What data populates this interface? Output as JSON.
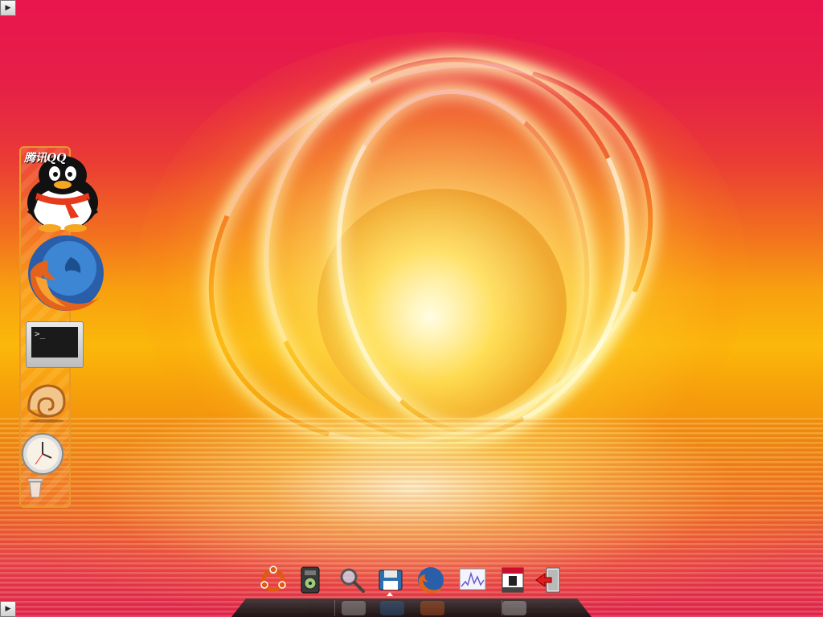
{
  "desktop": {
    "wallpaper": "fire-orb-over-water",
    "colors": {
      "sky_top": "#e8154e",
      "horizon": "#fbb80a",
      "water": "#ee6e22",
      "dock_border": "#e8992c"
    }
  },
  "edge_buttons": {
    "top_glyph": "▶",
    "bottom_glyph": "▶"
  },
  "side_dock": {
    "items": [
      {
        "name": "qq-icon",
        "label": "腾讯QQ"
      },
      {
        "name": "firefox-icon"
      },
      {
        "name": "terminal-icon",
        "prompt": ">_"
      },
      {
        "name": "nautilus-shell-icon"
      },
      {
        "name": "clock-icon"
      },
      {
        "name": "trash-icon"
      }
    ]
  },
  "bottom_dock": {
    "items": [
      {
        "name": "ubuntu-logo-icon"
      },
      {
        "name": "media-player-icon"
      },
      {
        "name": "search-magnifier-icon"
      },
      {
        "name": "save-floppy-icon"
      },
      {
        "name": "firefox-icon"
      },
      {
        "name": "system-monitor-icon"
      },
      {
        "name": "calendar-icon"
      },
      {
        "name": "logout-icon"
      }
    ]
  }
}
